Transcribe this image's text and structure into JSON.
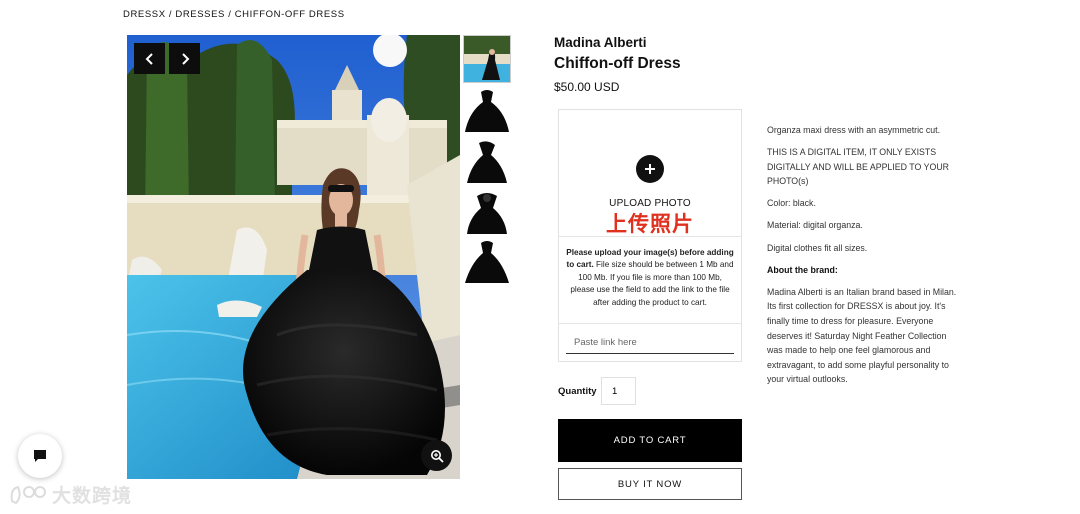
{
  "breadcrumb": [
    "DRESSX",
    "DRESSES",
    "CHIFFON-OFF DRESS"
  ],
  "breadcrumb_sep": " / ",
  "product": {
    "brand": "Madina Alberti",
    "title": "Chiffon-off Dress",
    "price": "$50.00 USD"
  },
  "gallery": {
    "prev_icon": "chevron-left-icon",
    "next_icon": "chevron-right-icon",
    "zoom_icon": "zoom-in-icon",
    "thumbnail_count": 5
  },
  "upload": {
    "icon": "plus-icon",
    "label": "UPLOAD PHOTO",
    "label_cn": "上传照片",
    "note_bold": "Please upload your image(s) before adding to cart.",
    "note_rest": " File size should be between 1 Mb and 100 Mb. If you file is more than 100 Mb, please use the field to add the link to the file after adding the product to cart.",
    "link_placeholder": "Paste link here"
  },
  "quantity": {
    "label": "Quantity",
    "value": "1"
  },
  "buttons": {
    "add_to_cart": "ADD TO CART",
    "buy_now": "BUY IT NOW"
  },
  "description": {
    "intro": "Organza maxi dress with an asymmetric cut.",
    "digital_notice": "THIS IS A DIGITAL ITEM, IT ONLY EXISTS DIGITALLY AND WILL BE APPLIED TO YOUR PHOTO(s)",
    "color": "Color: black.",
    "material": "Material: digital organza.",
    "fit": "Digital clothes fit all sizes.",
    "about_heading": "About the brand:",
    "about_text": "Madina Alberti is an Italian brand based in Milan. Its first collection for DRESSX is about joy. It's finally time to dress for pleasure. Everyone deserves it! Saturday Night Feather Collection was made to help one feel glamorous and extravagant, to add some playful personality to your virtual outlooks."
  },
  "chat": {
    "icon": "chat-bubble-icon"
  },
  "watermark": {
    "text": "大数跨境",
    "icon": "watermark-logo-icon"
  },
  "colors": {
    "accent": "#000000",
    "upload_cn": "#e0301e",
    "sky": "#2f6fd8",
    "pool": "#2fa6d8"
  }
}
